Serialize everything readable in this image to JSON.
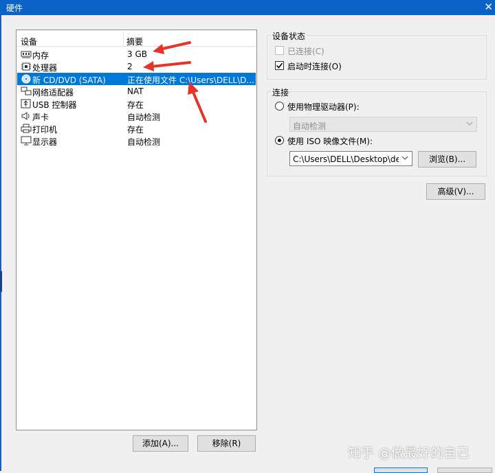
{
  "window": {
    "title": "硬件",
    "close_glyph": "✕"
  },
  "device_list": {
    "col_device": "设备",
    "col_summary": "摘要",
    "rows": [
      {
        "name": "内存",
        "summary": "3 GB",
        "icon": "memory-icon"
      },
      {
        "name": "处理器",
        "summary": "2",
        "icon": "processor-icon"
      },
      {
        "name": "新 CD/DVD (SATA)",
        "summary": "正在使用文件 C:\\Users\\DELL\\D...",
        "icon": "cd-dvd-icon",
        "selected": true
      },
      {
        "name": "网络适配器",
        "summary": "NAT",
        "icon": "network-adapter-icon"
      },
      {
        "name": "USB 控制器",
        "summary": "存在",
        "icon": "usb-icon"
      },
      {
        "name": "声卡",
        "summary": "自动检测",
        "icon": "speaker-icon"
      },
      {
        "name": "打印机",
        "summary": "存在",
        "icon": "printer-icon"
      },
      {
        "name": "显示器",
        "summary": "自动检测",
        "icon": "monitor-icon"
      }
    ]
  },
  "buttons": {
    "add": "添加(A)...",
    "remove": "移除(R)",
    "advanced": "高级(V)..."
  },
  "device_status": {
    "label": "设备状态",
    "connected": {
      "label": "已连接(C)",
      "checked": false,
      "disabled": true
    },
    "connect_on_power_on": {
      "label": "启动时连接(O)",
      "checked": true
    }
  },
  "connection": {
    "label": "连接",
    "physical_drive": {
      "label": "使用物理驱动器(P):",
      "selected": false
    },
    "physical_drive_value": "自动检测",
    "iso_image": {
      "label": "使用 ISO 映像文件(M):",
      "selected": true
    },
    "iso_path": "C:\\Users\\DELL\\Desktop\\dell\\",
    "browse": "浏览(B)..."
  },
  "watermark": "知乎 @做最好的自己",
  "colors": {
    "titlebar": "#0a64c8",
    "selection": "#0078d7",
    "annotation_arrow": "#e8332a"
  }
}
